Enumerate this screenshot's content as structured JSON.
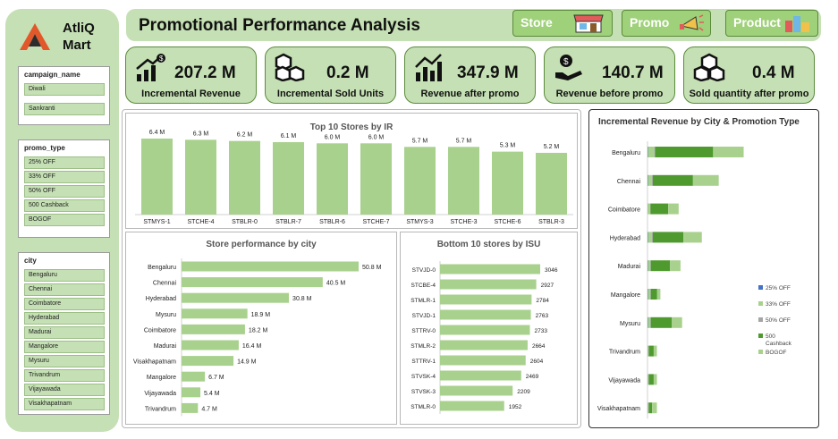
{
  "logo": {
    "line1": "AtliQ",
    "line2": "Mart"
  },
  "title": "Promotional Performance Analysis",
  "nav": [
    {
      "label": "Store"
    },
    {
      "label": "Promo"
    },
    {
      "label": "Product"
    }
  ],
  "slicers": [
    {
      "title": "campaign_name",
      "items": [
        "Diwali",
        "Sankranti"
      ]
    },
    {
      "title": "promo_type",
      "items": [
        "25% OFF",
        "33% OFF",
        "50% OFF",
        "500 Cashback",
        "BOGOF"
      ]
    },
    {
      "title": "city",
      "items": [
        "Bengaluru",
        "Chennai",
        "Coimbatore",
        "Hyderabad",
        "Madurai",
        "Mangalore",
        "Mysuru",
        "Trivandrum",
        "Vijayawada",
        "Visakhapatnam"
      ]
    }
  ],
  "kpis": [
    {
      "value": "207.2 M",
      "label": "Incremental Revenue",
      "icon": "growth-chart-icon"
    },
    {
      "value": "0.2 M",
      "label": "Incremental Sold Units",
      "icon": "boxes-icon"
    },
    {
      "value": "347.9 M",
      "label": "Revenue after promo",
      "icon": "bar-trend-icon"
    },
    {
      "value": "140.7 M",
      "label": "Revenue before promo",
      "icon": "money-hand-icon"
    },
    {
      "value": "0.4 M",
      "label": "Sold quantity after promo",
      "icon": "boxes-icon"
    }
  ],
  "colors": {
    "accent": "#c5e0b4",
    "bar": "#a9d18e",
    "dark_green": "#4e9a2e",
    "mid_green": "#70ad47",
    "light_green": "#a9d18e",
    "blue": "#4472c4",
    "gray": "#a5a5a5"
  },
  "chart_data": [
    {
      "type": "bar",
      "title": "Top 10 Stores by IR",
      "categories": [
        "STMYS-1",
        "STCHE-4",
        "STBLR-0",
        "STBLR-7",
        "STBLR-6",
        "STCHE-7",
        "STMYS-3",
        "STCHE-3",
        "STCHE-6",
        "STBLR-3"
      ],
      "values": [
        6.4,
        6.3,
        6.2,
        6.1,
        6.0,
        6.0,
        5.7,
        5.7,
        5.3,
        5.2
      ],
      "data_labels": [
        "6.4 M",
        "6.3 M",
        "6.2 M",
        "6.1 M",
        "6.0 M",
        "6.0 M",
        "5.7 M",
        "5.7 M",
        "5.3 M",
        "5.2 M"
      ],
      "grid": false
    },
    {
      "type": "bar",
      "orientation": "horizontal",
      "title": "Store performance by city",
      "categories": [
        "Bengaluru",
        "Chennai",
        "Hyderabad",
        "Mysuru",
        "Coimbatore",
        "Madurai",
        "Visakhapatnam",
        "Mangalore",
        "Vijayawada",
        "Trivandrum"
      ],
      "values": [
        50.8,
        40.5,
        30.8,
        18.9,
        18.2,
        16.4,
        14.9,
        6.7,
        5.4,
        4.7
      ],
      "data_labels": [
        "50.8 M",
        "40.5 M",
        "30.8 M",
        "18.9 M",
        "18.2 M",
        "16.4 M",
        "14.9 M",
        "6.7 M",
        "5.4 M",
        "4.7 M"
      ]
    },
    {
      "type": "bar",
      "orientation": "horizontal",
      "title": "Bottom 10 stores by ISU",
      "categories": [
        "STVJD-0",
        "STCBE-4",
        "STMLR-1",
        "STVJD-1",
        "STTRV-0",
        "STMLR-2",
        "STTRV-1",
        "STVSK-4",
        "STVSK-3",
        "STMLR-0"
      ],
      "values": [
        3046,
        2927,
        2784,
        2763,
        2733,
        2664,
        2604,
        2469,
        2209,
        1952
      ]
    },
    {
      "type": "bar",
      "orientation": "horizontal",
      "stacked": true,
      "title": "Incremental Revenue by City & Promotion Type",
      "categories": [
        "Bengaluru",
        "Chennai",
        "Coimbatore",
        "Hyderabad",
        "Madurai",
        "Mangalore",
        "Mysuru",
        "Trivandrum",
        "Vijayawada",
        "Visakhapatnam"
      ],
      "series": [
        {
          "name": "25% OFF",
          "values": [
            0.05,
            0.05,
            0.02,
            0.05,
            0.05,
            0.05,
            0.05,
            0.02,
            0.02,
            0.02
          ]
        },
        {
          "name": "33% OFF",
          "values": [
            0.8,
            0.5,
            0.3,
            0.5,
            0.3,
            0.3,
            0.3,
            0.1,
            0.1,
            0.1
          ]
        },
        {
          "name": "50% OFF",
          "values": [
            0.1,
            0.1,
            0.05,
            0.1,
            0.05,
            0.05,
            0.05,
            0.05,
            0.05,
            0.05
          ]
        },
        {
          "name": "500 Cashback",
          "values": [
            7.2,
            5.0,
            2.2,
            3.8,
            2.4,
            0.8,
            2.6,
            0.6,
            0.6,
            0.4
          ]
        },
        {
          "name": "BOGOF",
          "values": [
            3.8,
            3.2,
            1.3,
            2.3,
            1.3,
            0.4,
            1.3,
            0.4,
            0.4,
            0.6
          ]
        }
      ],
      "legend": "right"
    }
  ]
}
